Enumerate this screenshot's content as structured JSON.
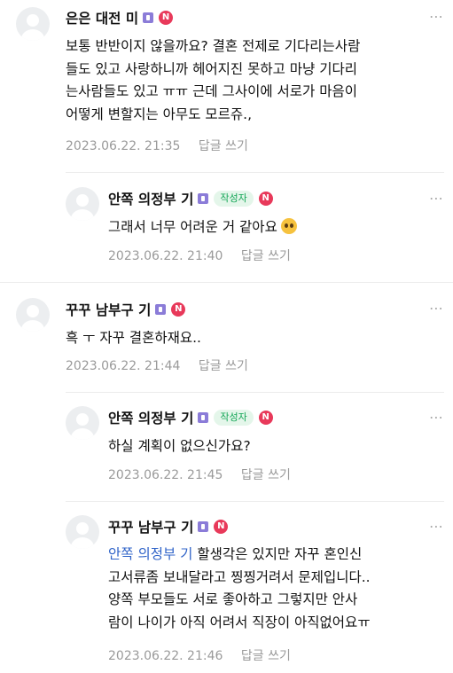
{
  "reply_label": "답글 쓰기",
  "more_icon": "⋯",
  "comments": [
    {
      "author": "은은 대전 미",
      "n_badge": "N",
      "lines": [
        "보통 반반이지 않을까요? 결혼 전제로 기다리는사람",
        "들도 있고 사랑하니까 헤어지진 못하고 마냥 기다리",
        "는사람들도 있고 ㅠㅠ 근데 그사이에 서로가 마음이",
        "어떻게 변할지는 아무도 모르쥬.,"
      ],
      "timestamp": "2023.06.22. 21:35"
    },
    {
      "author": "안쪽 의정부 기",
      "author_badge": "작성자",
      "n_badge": "N",
      "lines": [
        "그래서 너무 어려운 거 같아요"
      ],
      "emoji": "pleading-face-icon",
      "timestamp": "2023.06.22. 21:40"
    },
    {
      "author": "꾸꾸 남부구 기",
      "n_badge": "N",
      "lines": [
        "흑 ㅜ 자꾸 결혼하재요.."
      ],
      "timestamp": "2023.06.22. 21:44"
    },
    {
      "author": "안쪽 의정부 기",
      "author_badge": "작성자",
      "n_badge": "N",
      "lines": [
        "하실 계획이 없으신가요?"
      ],
      "timestamp": "2023.06.22. 21:45"
    },
    {
      "author": "꾸꾸 남부구 기",
      "n_badge": "N",
      "mention": "안쪽 의정부 기",
      "lines": [
        " 할생각은 있지만 자꾸 혼인신",
        "고서류좀 보내달라고 찡찡거려서 문제입니다..",
        " 양쪽 부모들도 서로 좋아하고 그렇지만 안사",
        "람이 나이가 아직 어려서 직장이 아직없어요ㅠ"
      ],
      "timestamp": "2023.06.22. 21:46"
    }
  ]
}
